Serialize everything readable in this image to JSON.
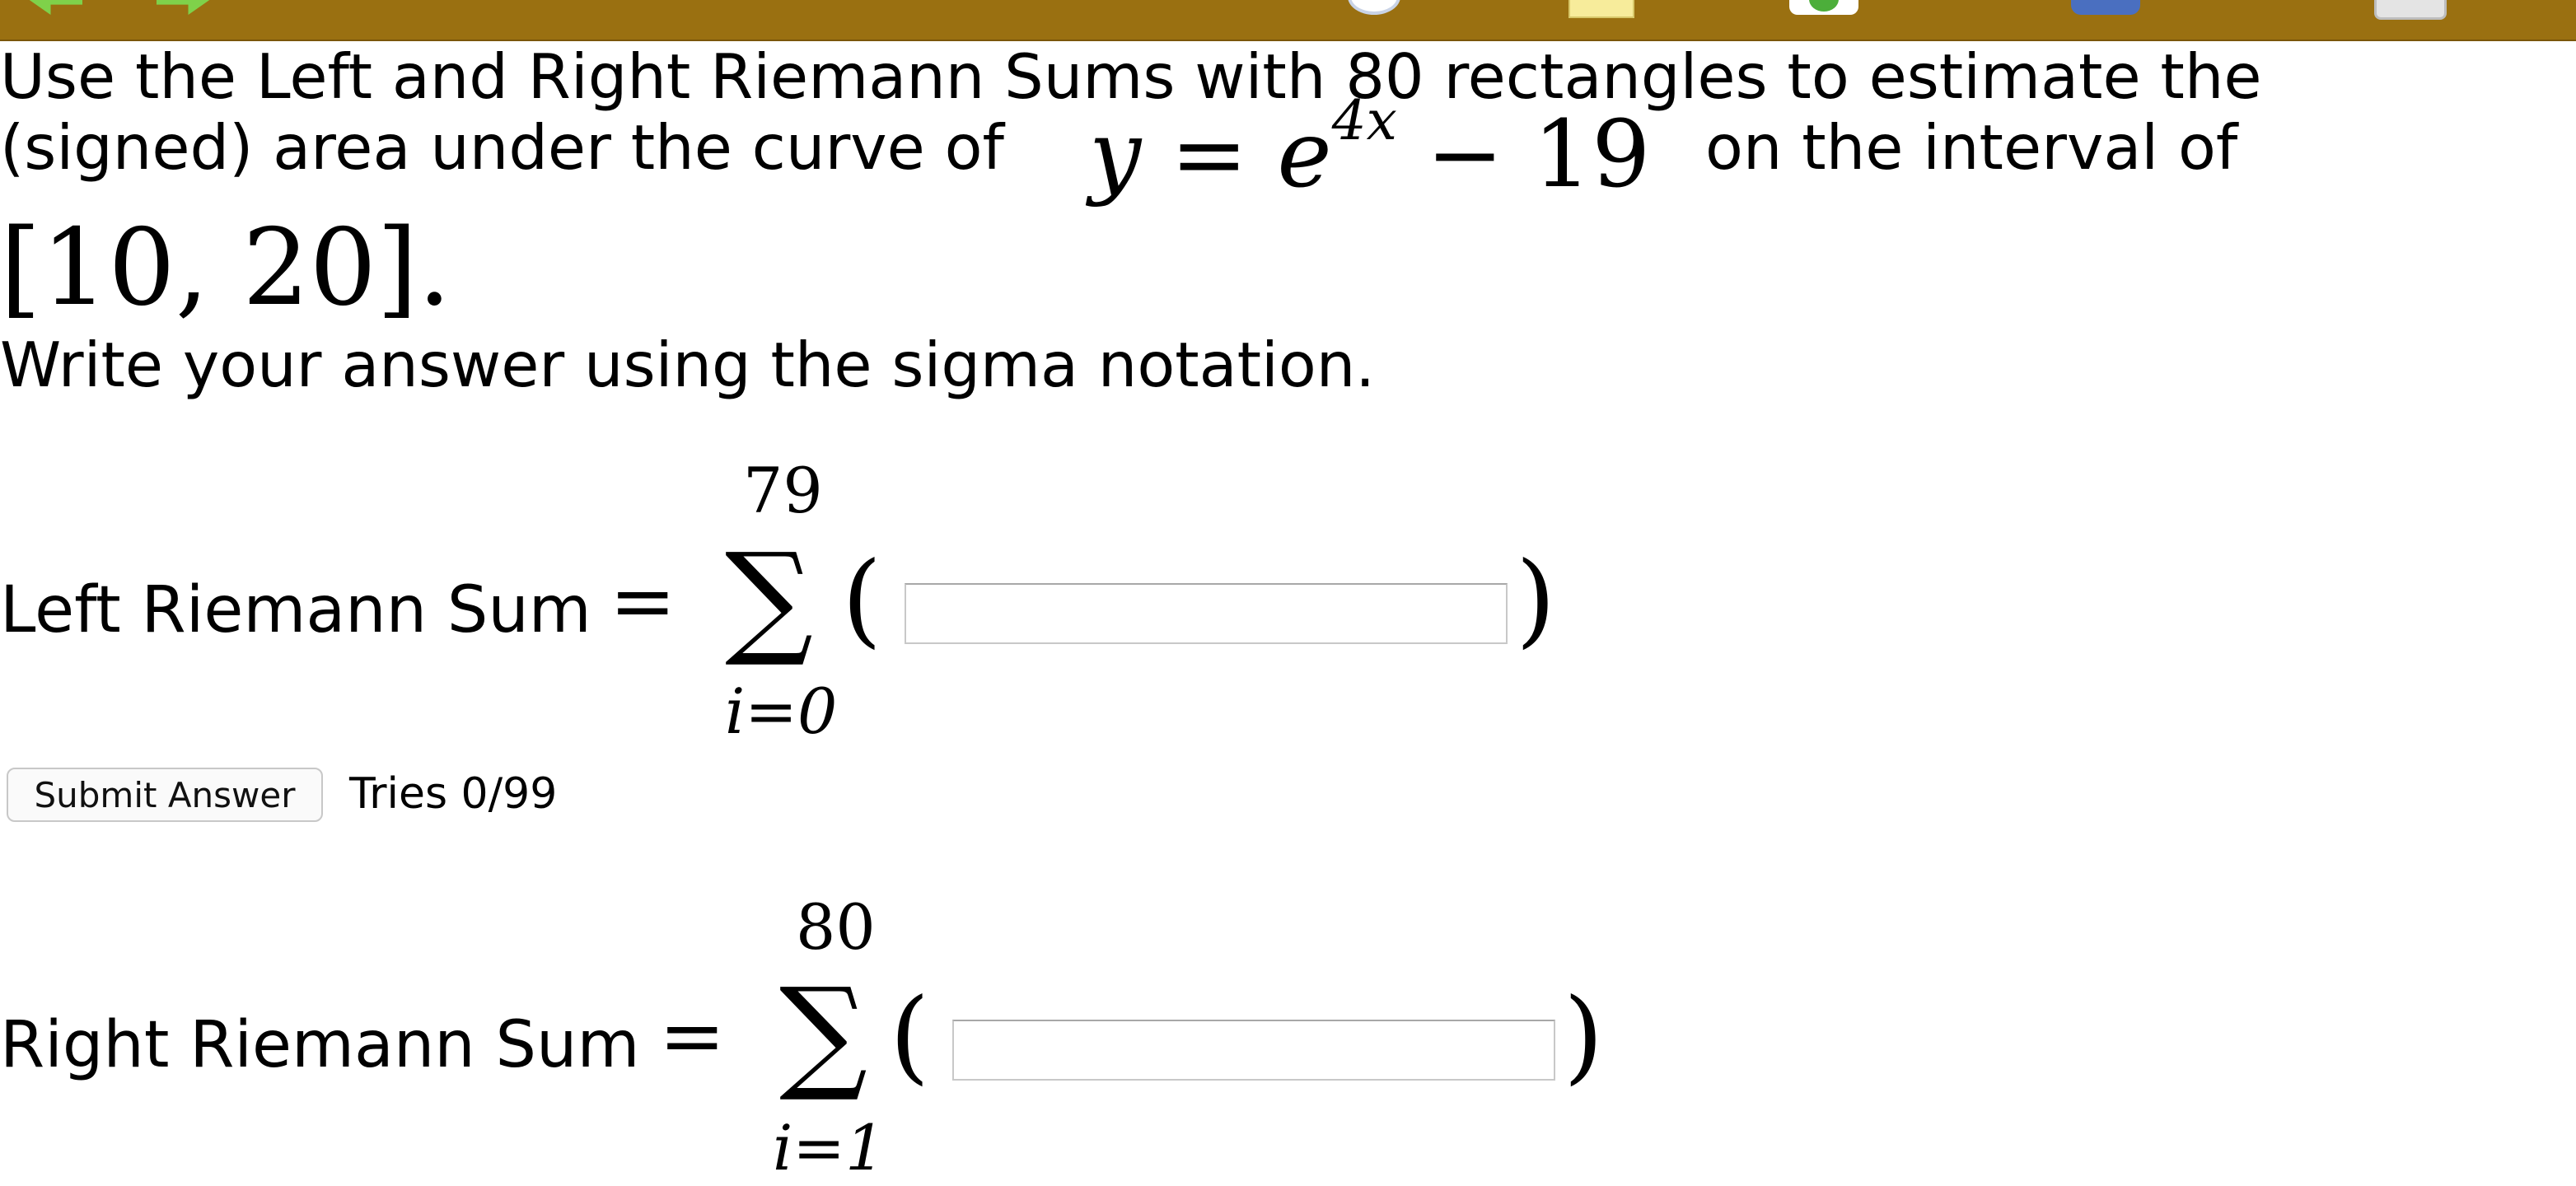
{
  "toolbar": {
    "color": "#9a7011",
    "icons": [
      "back-arrow-icon",
      "forward-arrow-icon",
      "clock-icon",
      "note-icon",
      "green-circle-icon",
      "blue-tool-icon",
      "gray-tool-icon"
    ]
  },
  "question": {
    "line1": "Use the Left and Right Riemann Sums with 80 rectangles to estimate the",
    "line2_prefix": "(signed) area under the curve of",
    "eq_y": "y",
    "eq_equals": " = ",
    "eq_e": "e",
    "eq_exponent": "4x",
    "eq_rest": " − 19",
    "line2_suffix": "on the interval of",
    "interval": "[10, 20].",
    "line3": "Write your answer using the sigma notation."
  },
  "left_sum": {
    "label": "Left Riemann Sum",
    "equals": "=",
    "sigma": "∑",
    "upper": "79",
    "lower": "i=0",
    "open_paren": "(",
    "close_paren": ")",
    "value": "",
    "placeholder": ""
  },
  "submit": {
    "label": "Submit Answer",
    "tries": "Tries 0/99"
  },
  "right_sum": {
    "label": "Right Riemann Sum",
    "equals": "=",
    "sigma": "∑",
    "upper": "80",
    "lower": "i=1",
    "open_paren": "(",
    "close_paren": ")",
    "value": "",
    "placeholder": ""
  }
}
